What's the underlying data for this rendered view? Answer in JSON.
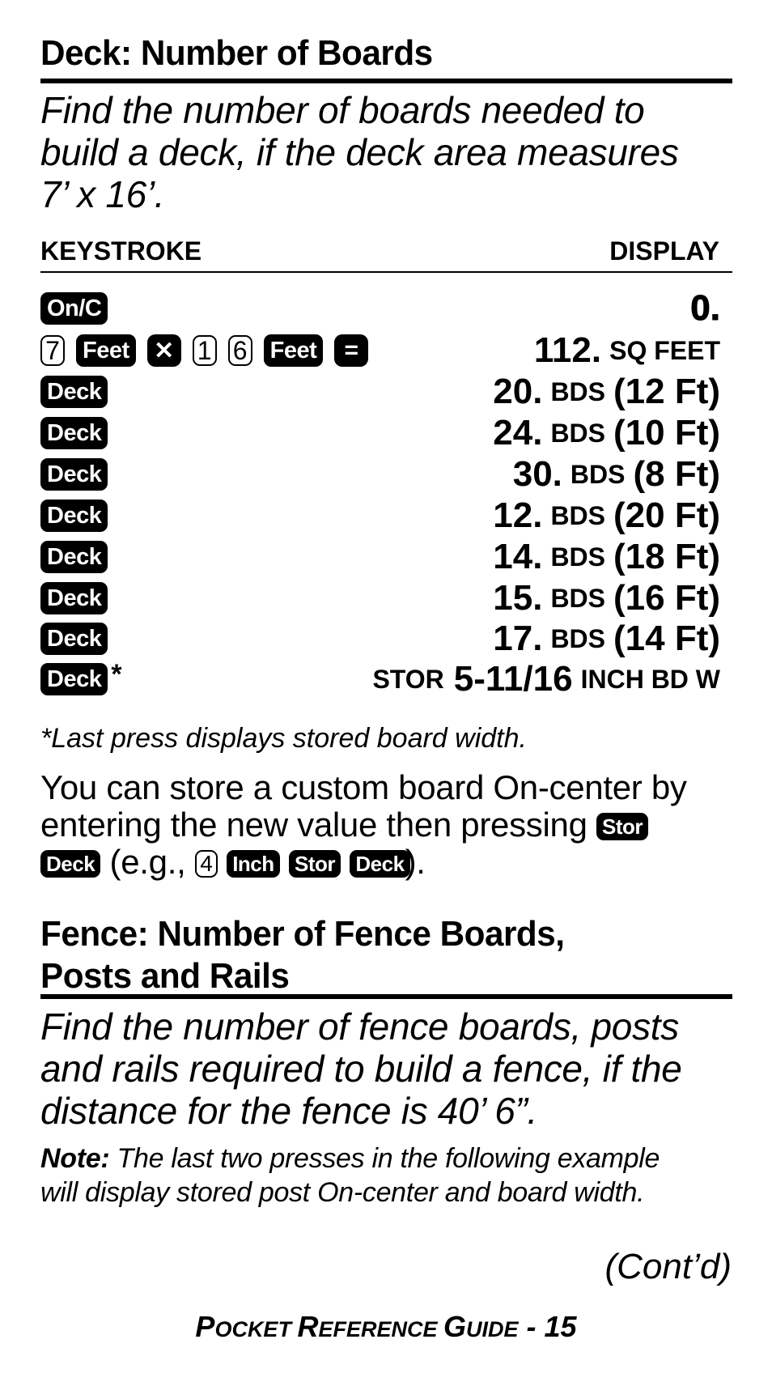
{
  "deck_section": {
    "heading": "Deck: Number of Boards",
    "lead_lines": [
      "Find the number of boards needed to",
      "build a deck, if the deck area measures",
      "7’ x 16’."
    ],
    "columns": {
      "keystroke": "KEYSTROKE",
      "display": "DISPLAY"
    },
    "rows": [
      {
        "keys": [
          {
            "type": "dark",
            "label": "On/C"
          }
        ],
        "display": {
          "value": "0.",
          "unit_small": "",
          "unit": ""
        }
      },
      {
        "keys": [
          {
            "type": "light",
            "label": "7"
          },
          {
            "type": "dark",
            "label": "Feet"
          },
          {
            "type": "sym",
            "label": "✕",
            "icon": "multiply-icon"
          },
          {
            "type": "light",
            "label": "1"
          },
          {
            "type": "light",
            "label": "6"
          },
          {
            "type": "dark",
            "label": "Feet"
          },
          {
            "type": "sym",
            "label": "=",
            "icon": "equals-icon"
          }
        ],
        "display": {
          "value": "112.",
          "unit_small": "SQ FEET",
          "unit": ""
        }
      },
      {
        "keys": [
          {
            "type": "dark",
            "label": "Deck"
          }
        ],
        "display": {
          "value": "20.",
          "unit_small": "BDS",
          "unit": "(12 Ft)"
        }
      },
      {
        "keys": [
          {
            "type": "dark",
            "label": "Deck"
          }
        ],
        "display": {
          "value": "24.",
          "unit_small": "BDS",
          "unit": "(10 Ft)"
        }
      },
      {
        "keys": [
          {
            "type": "dark",
            "label": "Deck"
          }
        ],
        "display": {
          "value": "30.",
          "unit_small": "BDS",
          "unit": "(8 Ft)"
        }
      },
      {
        "keys": [
          {
            "type": "dark",
            "label": "Deck"
          }
        ],
        "display": {
          "value": "12.",
          "unit_small": "BDS",
          "unit": "(20 Ft)"
        }
      },
      {
        "keys": [
          {
            "type": "dark",
            "label": "Deck"
          }
        ],
        "display": {
          "value": "14.",
          "unit_small": "BDS",
          "unit": "(18 Ft)"
        }
      },
      {
        "keys": [
          {
            "type": "dark",
            "label": "Deck"
          }
        ],
        "display": {
          "value": "15.",
          "unit_small": "BDS",
          "unit": "(16 Ft)"
        }
      },
      {
        "keys": [
          {
            "type": "dark",
            "label": "Deck"
          }
        ],
        "display": {
          "value": "17.",
          "unit_small": "BDS",
          "unit": "(14 Ft)"
        }
      }
    ],
    "last_row": {
      "key": "Deck",
      "star": "*",
      "prefix": "STOR",
      "value": "5-11/16",
      "suffix": "INCH BD W"
    },
    "footnote": "*Last press displays stored board width.",
    "custom": {
      "line1": "You can store a custom board On-center by",
      "line2_text": "entering the new value then pressing",
      "key_stor": "Stor",
      "key_deck": "Deck",
      "eg_open": "(e.g.,",
      "key_4": "4",
      "key_inch": "Inch",
      "eg_close": ")."
    }
  },
  "fence_section": {
    "heading_lines": [
      "Fence: Number of Fence Boards,",
      "Posts and Rails"
    ],
    "lead_lines": [
      "Find the number of fence boards, posts",
      "and rails required to build a fence, if the",
      "distance for the fence is 40’ 6”."
    ],
    "note_label": "Note:",
    "note_line1": " The last two presses in the following example",
    "note_line2": "will display stored post On-center and board width.",
    "contd": "(Cont’d)"
  },
  "footer": {
    "p": "P",
    "ocket": "OCKET ",
    "r": "R",
    "eference": "EFERENCE ",
    "g": "G",
    "uide": "UIDE",
    "page": " - 15"
  }
}
